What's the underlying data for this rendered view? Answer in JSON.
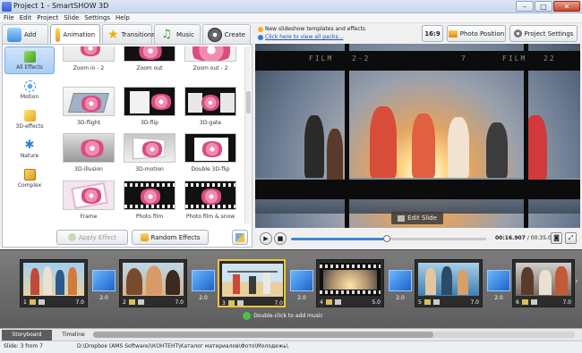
{
  "window": {
    "title": "Project 1 - SmartSHOW 3D",
    "min": "–",
    "max": "□",
    "close": "✕"
  },
  "menu": [
    "File",
    "Edit",
    "Project",
    "Slide",
    "Settings",
    "Help"
  ],
  "tabs": [
    {
      "label": "Add",
      "icon": "folder-plus-icon"
    },
    {
      "label": "Animation",
      "icon": "animation-icon"
    },
    {
      "label": "Transitions",
      "icon": "star-icon"
    },
    {
      "label": "Music",
      "icon": "music-icon"
    },
    {
      "label": "Create",
      "icon": "film-reel-icon"
    }
  ],
  "news": {
    "line1": "New slideshow templates and effects",
    "line2": "Click here to view all packs..."
  },
  "toolbar": {
    "aspect": "16:9",
    "photo_position": "Photo Position",
    "project_settings": "Project Settings"
  },
  "categories": [
    {
      "label": "All Effects",
      "active": true
    },
    {
      "label": "Motion"
    },
    {
      "label": "3D-effects"
    },
    {
      "label": "Nature"
    },
    {
      "label": "Complex"
    }
  ],
  "effects": [
    {
      "label": "Zoom in - 2"
    },
    {
      "label": "Zoom out"
    },
    {
      "label": "Zoom out - 2"
    },
    {
      "label": "3D-flight"
    },
    {
      "label": "3D-flip"
    },
    {
      "label": "3D-gate"
    },
    {
      "label": "3D-illusion"
    },
    {
      "label": "3D-motion"
    },
    {
      "label": "Double 3D-flip"
    },
    {
      "label": "Frame"
    },
    {
      "label": "Photo film"
    },
    {
      "label": "Photo film & snow"
    }
  ],
  "actions": {
    "apply": "Apply Effect",
    "random": "Random Effects"
  },
  "preview": {
    "film_text": [
      "FILM",
      "2-2",
      "7",
      "FILM",
      "22"
    ],
    "edit_slide": "Edit Slide"
  },
  "player": {
    "current": "00:16.907",
    "total": "/ 00:35.000",
    "progress": 0.49
  },
  "slides": [
    {
      "num": "1",
      "duration": "7.0",
      "trans": "2.0"
    },
    {
      "num": "2",
      "duration": "7.0",
      "trans": "2.0"
    },
    {
      "num": "3",
      "duration": "7.0",
      "trans": "2.0"
    },
    {
      "num": "4",
      "duration": "5.0",
      "trans": "2.0"
    },
    {
      "num": "5",
      "duration": "7.0",
      "trans": "2.0"
    },
    {
      "num": "6",
      "duration": "7.0"
    }
  ],
  "music_hint": "Double-click to add music",
  "bottom_tabs": [
    "Storyboard",
    "Timeline"
  ],
  "status": {
    "slide": "Slide: 3 from 7",
    "path": "D:\\Dropbox (AMS Software)\\КОНТЕНТ\\Каталог материалов\\Фото\\Молодежь\\"
  }
}
